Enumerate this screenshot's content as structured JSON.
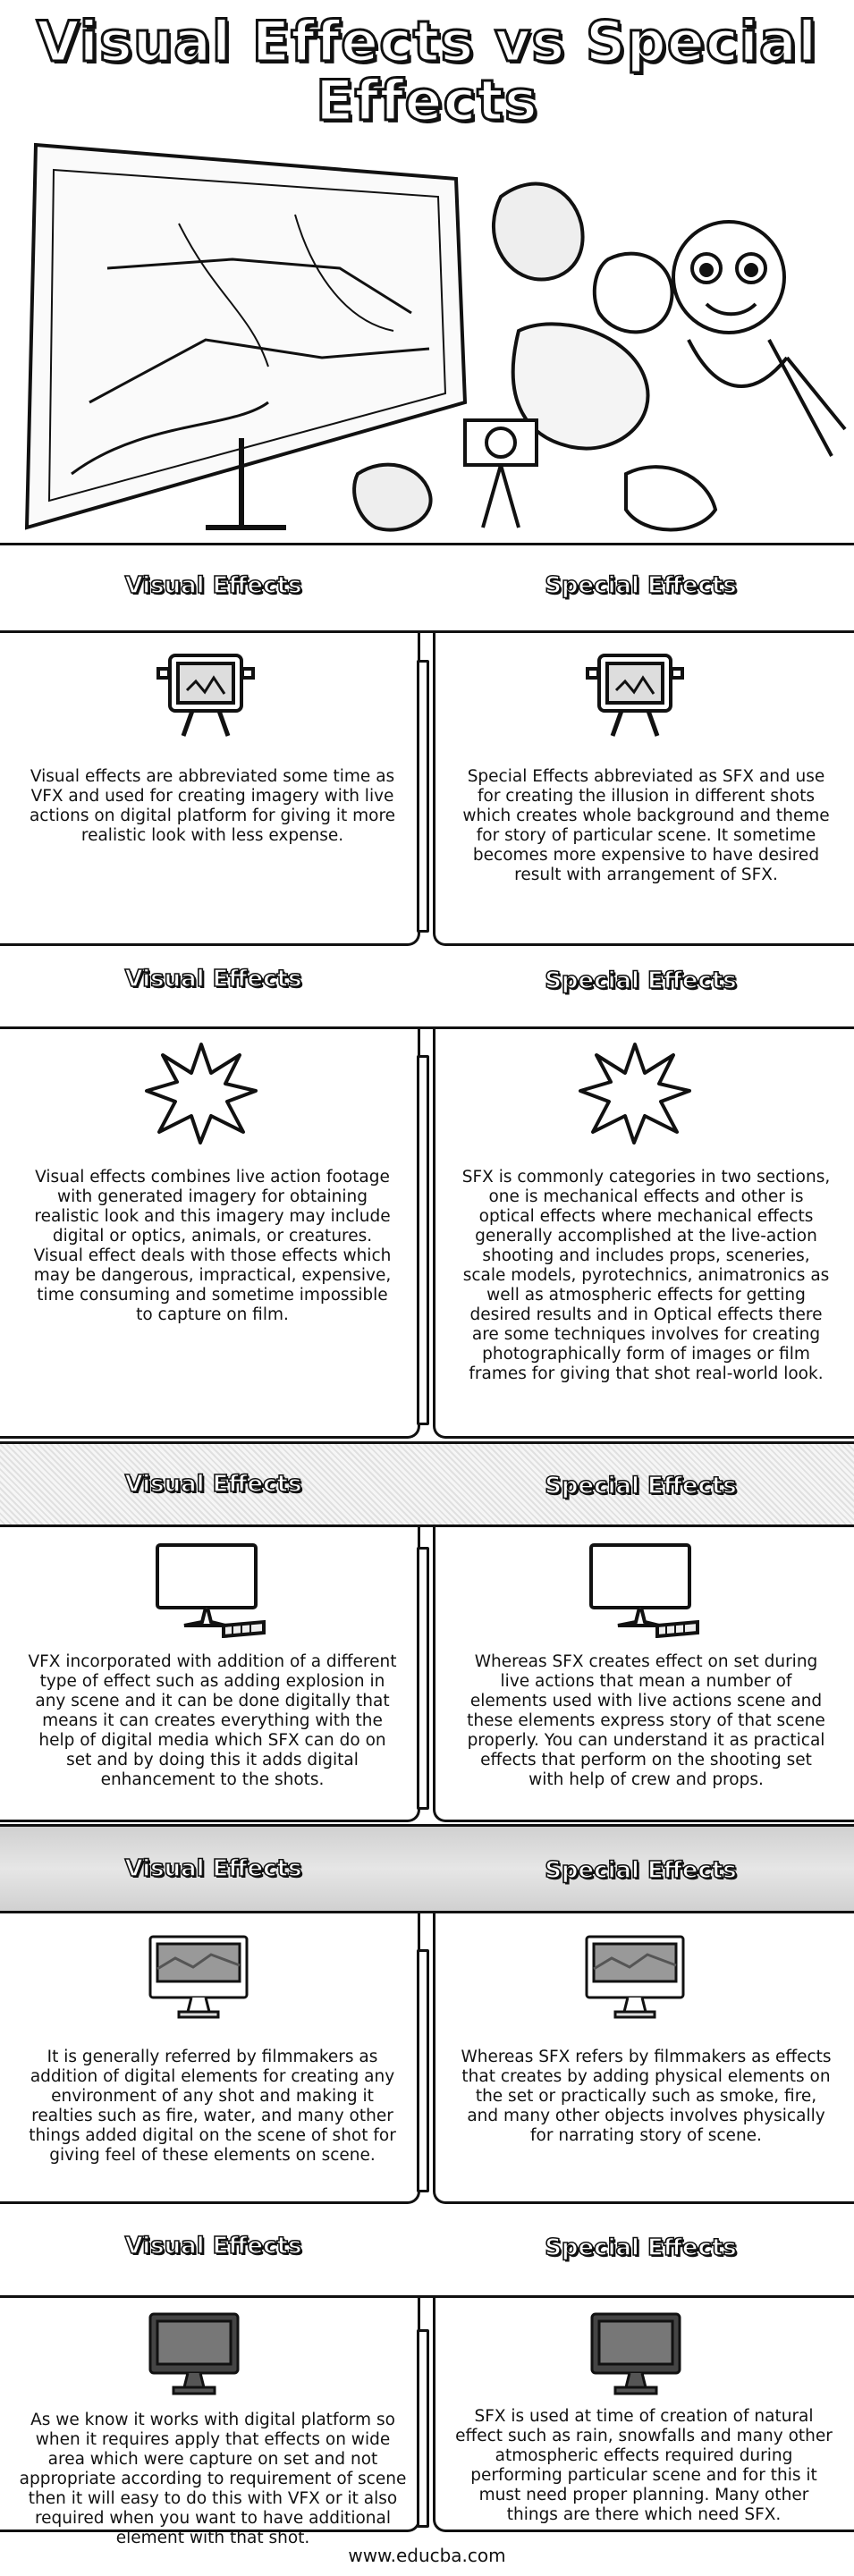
{
  "title": "Visual Effects vs Special Effects",
  "footer": "www.educba.com",
  "sections": [
    {
      "left_heading": "Visual Effects",
      "right_heading": "Special Effects",
      "left_text": "Visual effects are abbreviated some time as VFX and used for creating imagery with live actions on digital platform for giving it more realistic look with less expense.",
      "right_text": "Special Effects abbreviated as SFX and use for creating the illusion in different shots which creates whole background and theme for story of particular scene. It sometime becomes more expensive to have desired result with arrangement of SFX."
    },
    {
      "left_heading": "Visual Effects",
      "right_heading": "Special Effects",
      "left_text": "Visual effects combines live action footage with generated imagery for obtaining realistic look and this imagery may include digital or optics, animals, or creatures. Visual effect deals with those effects which may be dangerous, impractical, expensive, time consuming and sometime impossible to capture on film.",
      "right_text": "SFX is commonly categories in two sections, one is mechanical effects and other is optical effects where mechanical effects generally accomplished at the live-action shooting and includes props, sceneries, scale models, pyrotechnics, animatronics as well as atmospheric effects for getting desired results and in Optical effects there are some techniques involves for creating photographically form of images or film frames for giving that shot real-world look."
    },
    {
      "left_heading": "Visual Effects",
      "right_heading": "Special Effects",
      "left_text": "VFX incorporated with addition of a different type of effect such as adding explosion in any scene and it can be done digitally that means it can creates everything with the help of digital media which SFX can do on set and by doing this it adds digital enhancement to the shots.",
      "right_text": "Whereas SFX creates effect on set during live actions that mean a number of elements used with live actions scene and these elements express story of that scene properly. You can understand it as practical effects that perform on the shooting set with help of crew and props."
    },
    {
      "left_heading": "Visual Effects",
      "right_heading": "Special Effects",
      "left_text": "It is generally referred by filmmakers as addition of digital elements for creating any environment of any shot and making it realties such as fire, water, and many other things added digital on the scene of shot for giving feel of these elements on scene.",
      "right_text": "Whereas SFX refers by filmmakers as effects that creates by adding physical elements on the set or practically such as smoke, fire, and many other objects involves physically for narrating story of scene."
    },
    {
      "left_heading": "Visual Effects",
      "right_heading": "Special Effects",
      "left_text": "As we know it works with digital platform so when it requires apply that effects on wide area which were capture on set and not appropriate according to requirement of scene then it will easy to do this with VFX or it also required when you want to have additional element with that shot.",
      "right_text": "SFX is used at time of creation of natural effect such as rain, snowfalls and many other atmospheric effects required during performing particular scene and for this it must need proper planning. Many other things are there which need SFX."
    }
  ],
  "icons": {
    "hero": "film-production-scene-illustration",
    "s1": "film-projector-icon",
    "s2": "starburst-icon",
    "s3": "desktop-monitor-icon",
    "s4": "monitor-with-image-icon",
    "s5": "dark-monitor-icon"
  }
}
